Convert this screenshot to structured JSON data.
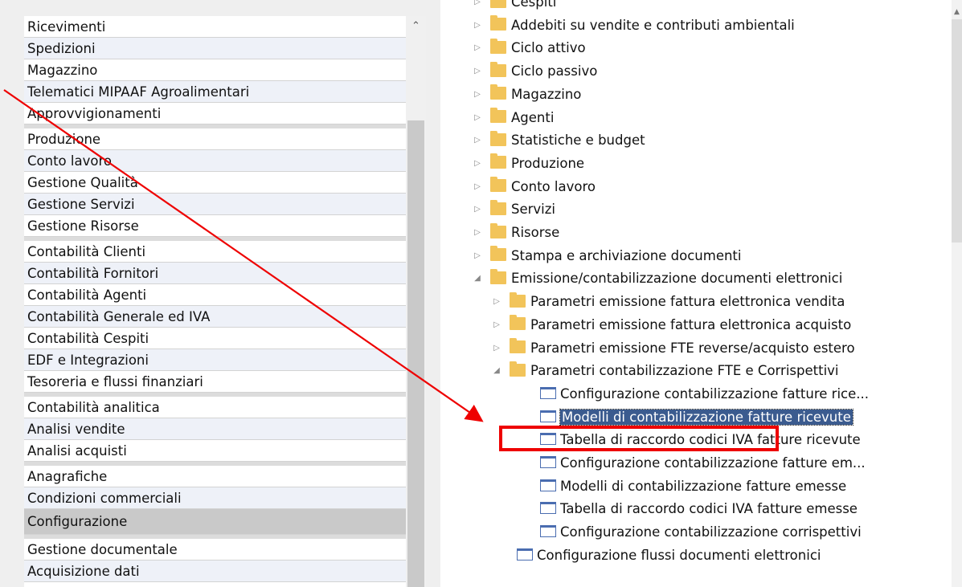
{
  "left_menu": {
    "groups": [
      {
        "items": [
          {
            "label": "Ricevimenti"
          },
          {
            "label": "Spedizioni"
          },
          {
            "label": "Magazzino"
          },
          {
            "label": "Telematici MIPAAF Agroalimentari"
          },
          {
            "label": "Approvvigionamenti"
          }
        ]
      },
      {
        "items": [
          {
            "label": "Produzione"
          },
          {
            "label": "Conto lavoro"
          },
          {
            "label": "Gestione Qualità"
          },
          {
            "label": "Gestione Servizi"
          },
          {
            "label": "Gestione Risorse"
          }
        ]
      },
      {
        "items": [
          {
            "label": "Contabilità Clienti"
          },
          {
            "label": "Contabilità Fornitori"
          },
          {
            "label": "Contabilità Agenti"
          },
          {
            "label": "Contabilità Generale ed IVA"
          },
          {
            "label": "Contabilità Cespiti"
          },
          {
            "label": "EDF e Integrazioni"
          },
          {
            "label": "Tesoreria e flussi finanziari"
          }
        ]
      },
      {
        "items": [
          {
            "label": "Contabilità analitica"
          },
          {
            "label": "Analisi vendite"
          },
          {
            "label": "Analisi acquisti"
          }
        ]
      },
      {
        "items": [
          {
            "label": "Anagrafiche"
          },
          {
            "label": "Condizioni commerciali"
          },
          {
            "label": "Configurazione",
            "selected": true
          }
        ]
      },
      {
        "items": [
          {
            "label": "Gestione documentale"
          },
          {
            "label": "Acquisizione dati"
          }
        ]
      }
    ],
    "scroll_up_icon": "chevron-up-icon"
  },
  "tree": [
    {
      "label": "Cespiti",
      "type": "folder",
      "expanded": false
    },
    {
      "label": "Addebiti su vendite e contributi ambientali",
      "type": "folder",
      "expanded": false
    },
    {
      "label": "Ciclo attivo",
      "type": "folder",
      "expanded": false
    },
    {
      "label": "Ciclo passivo",
      "type": "folder",
      "expanded": false
    },
    {
      "label": "Magazzino",
      "type": "folder",
      "expanded": false
    },
    {
      "label": "Agenti",
      "type": "folder",
      "expanded": false
    },
    {
      "label": "Statistiche e budget",
      "type": "folder",
      "expanded": false
    },
    {
      "label": "Produzione",
      "type": "folder",
      "expanded": false
    },
    {
      "label": "Conto lavoro",
      "type": "folder",
      "expanded": false
    },
    {
      "label": "Servizi",
      "type": "folder",
      "expanded": false
    },
    {
      "label": "Risorse",
      "type": "folder",
      "expanded": false
    },
    {
      "label": "Stampa e archiviazione documenti",
      "type": "folder",
      "expanded": false
    },
    {
      "label": "Emissione/contabilizzazione documenti elettronici",
      "type": "folder",
      "expanded": true
    },
    {
      "label": "Parametri emissione fattura elettronica vendita",
      "type": "folder",
      "expanded": false,
      "level": 1
    },
    {
      "label": "Parametri emissione fattura elettronica acquisto",
      "type": "folder",
      "expanded": false,
      "level": 1
    },
    {
      "label": "Parametri emissione FTE reverse/acquisto estero",
      "type": "folder",
      "expanded": false,
      "level": 1
    },
    {
      "label": "Parametri contabilizzazione FTE e Corrispettivi",
      "type": "folder",
      "expanded": true,
      "level": 1
    },
    {
      "label": "Configurazione contabilizzazione fatture rice...",
      "type": "doc",
      "level": 2
    },
    {
      "label": "Modelli di contabilizzazione fatture ricevute",
      "type": "doc",
      "level": 2,
      "selected": true
    },
    {
      "label": "Tabella di raccordo codici IVA fatture ricevute",
      "type": "doc",
      "level": 2
    },
    {
      "label": "Configurazione contabilizzazione fatture em...",
      "type": "doc",
      "level": 2
    },
    {
      "label": "Modelli di contabilizzazione fatture emesse",
      "type": "doc",
      "level": 2
    },
    {
      "label": "Tabella di raccordo codici IVA fatture emesse",
      "type": "doc",
      "level": 2
    },
    {
      "label": "Configurazione contabilizzazione corrispettivi",
      "type": "doc",
      "level": 2
    },
    {
      "label": "Configurazione flussi documenti elettronici",
      "type": "doc",
      "level": 1
    }
  ],
  "annotation": {
    "color": "#ee0000"
  },
  "colors": {
    "selection": "#3b5b8f",
    "folder": "#f2c45a",
    "doc_icon": "#4a6db0"
  }
}
